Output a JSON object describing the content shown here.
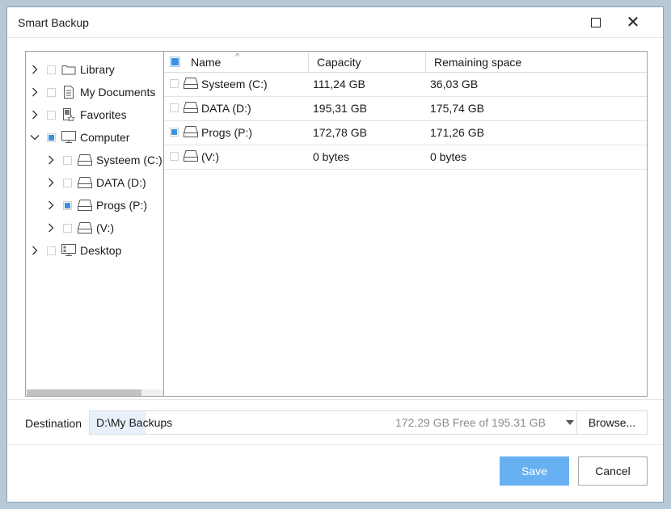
{
  "window": {
    "title": "Smart Backup"
  },
  "tree": {
    "items": [
      {
        "label": "Library",
        "icon": "folder-icon",
        "level": 0,
        "expanded": false,
        "checked": "none"
      },
      {
        "label": "My Documents",
        "icon": "document-icon",
        "level": 0,
        "expanded": false,
        "checked": "none"
      },
      {
        "label": "Favorites",
        "icon": "favorites-icon",
        "level": 0,
        "expanded": false,
        "checked": "none"
      },
      {
        "label": "Computer",
        "icon": "monitor-icon",
        "level": 0,
        "expanded": true,
        "checked": "partial"
      },
      {
        "label": "Systeem (C:)",
        "icon": "drive-icon",
        "level": 1,
        "expanded": false,
        "checked": "none"
      },
      {
        "label": "DATA (D:)",
        "icon": "drive-icon",
        "level": 1,
        "expanded": false,
        "checked": "none"
      },
      {
        "label": "Progs (P:)",
        "icon": "drive-icon",
        "level": 1,
        "expanded": false,
        "checked": "partial"
      },
      {
        "label": "(V:)",
        "icon": "drive-icon",
        "level": 1,
        "expanded": false,
        "checked": "none"
      },
      {
        "label": "Desktop",
        "icon": "desktop-icon",
        "level": 0,
        "expanded": false,
        "checked": "none"
      }
    ]
  },
  "list": {
    "columns": [
      "Name",
      "Capacity",
      "Remaining space"
    ],
    "sort_indicator": "^",
    "rows": [
      {
        "name": "Systeem (C:)",
        "capacity": "111,24 GB",
        "remaining": "36,03 GB",
        "checked": "none"
      },
      {
        "name": "DATA (D:)",
        "capacity": "195,31 GB",
        "remaining": "175,74 GB",
        "checked": "none"
      },
      {
        "name": "Progs (P:)",
        "capacity": "172,78 GB",
        "remaining": "171,26 GB",
        "checked": "partial"
      },
      {
        "name": "(V:)",
        "capacity": "0 bytes",
        "remaining": "0 bytes",
        "checked": "none"
      }
    ]
  },
  "destination": {
    "label": "Destination",
    "path": "D:\\My Backups",
    "free": "172.29 GB Free of 195.31 GB",
    "browse_label": "Browse..."
  },
  "buttons": {
    "save": "Save",
    "cancel": "Cancel"
  },
  "colors": {
    "accent": "#3d8fe0",
    "save_bg": "#67b1f2"
  }
}
